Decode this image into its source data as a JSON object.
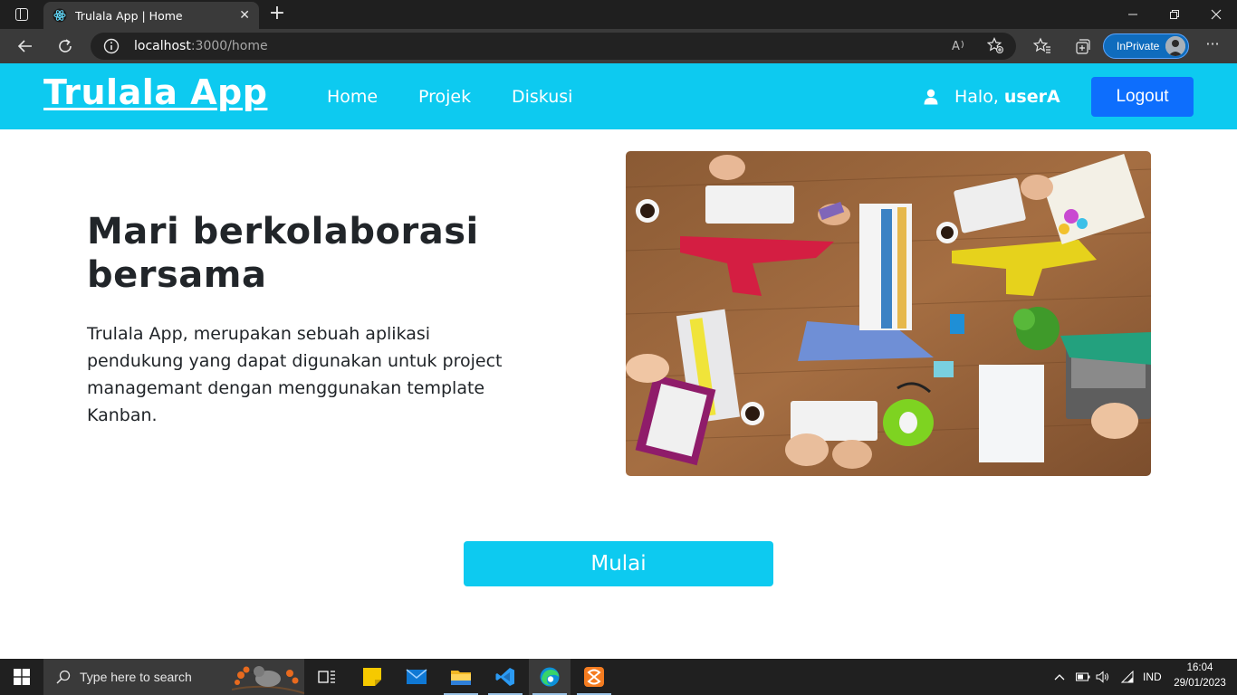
{
  "browser": {
    "tab_title": "Trulala App | Home",
    "url_host": "localhost",
    "url_path": ":3000/home",
    "inprivate_label": "InPrivate"
  },
  "navbar": {
    "brand": "Trulala App",
    "links": [
      "Home",
      "Projek",
      "Diskusi"
    ],
    "greeting": "Halo,",
    "username": "userA",
    "logout_label": "Logout"
  },
  "hero": {
    "title": "Mari berkolaborasi bersama",
    "description": "Trulala App, merupakan sebuah aplikasi pendukung yang dapat digunakan untuk project managemant dengan menggunakan template Kanban.",
    "cta_label": "Mulai"
  },
  "taskbar": {
    "search_placeholder": "Type here to search",
    "language": "IND",
    "time": "16:04",
    "date": "29/01/2023"
  },
  "colors": {
    "navbar": "#0dcaf0",
    "logout_button": "#0d6efd",
    "cta_button": "#0dcaf0",
    "text_dark": "#212529"
  }
}
